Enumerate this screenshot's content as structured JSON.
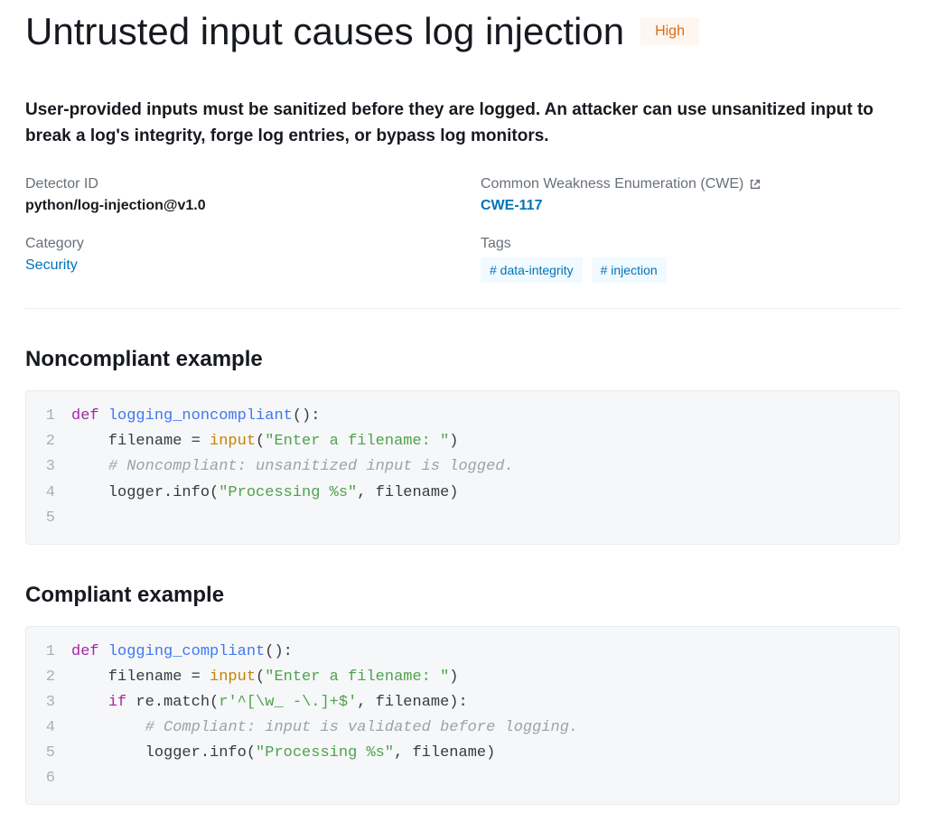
{
  "header": {
    "title": "Untrusted input causes log injection",
    "severity": "High"
  },
  "description": "User-provided inputs must be sanitized before they are logged. An attacker can use unsanitized input to break a log's integrity, forge log entries, or bypass log monitors.",
  "meta": {
    "detector_id_label": "Detector ID",
    "detector_id": "python/log-injection@v1.0",
    "cwe_label": "Common Weakness Enumeration (CWE)",
    "cwe_link": "CWE-117",
    "category_label": "Category",
    "category": "Security",
    "tags_label": "Tags",
    "tags": [
      "# data-integrity",
      "# injection"
    ]
  },
  "sections": {
    "noncompliant_title": "Noncompliant example",
    "compliant_title": "Compliant example"
  },
  "code": {
    "noncompliant": [
      {
        "n": "1",
        "tokens": [
          [
            "kw",
            "def "
          ],
          [
            "fn",
            "logging_noncompliant"
          ],
          [
            "plain",
            "():"
          ]
        ]
      },
      {
        "n": "2",
        "tokens": [
          [
            "plain",
            "    filename = "
          ],
          [
            "builtin",
            "input"
          ],
          [
            "plain",
            "("
          ],
          [
            "str",
            "\"Enter a filename: \""
          ],
          [
            "plain",
            ")"
          ]
        ]
      },
      {
        "n": "3",
        "tokens": [
          [
            "plain",
            "    "
          ],
          [
            "comment",
            "# Noncompliant: unsanitized input is logged."
          ]
        ]
      },
      {
        "n": "4",
        "tokens": [
          [
            "plain",
            "    logger.info("
          ],
          [
            "str",
            "\"Processing %s\""
          ],
          [
            "plain",
            ", filename)"
          ]
        ]
      },
      {
        "n": "5",
        "tokens": []
      }
    ],
    "compliant": [
      {
        "n": "1",
        "tokens": [
          [
            "kw",
            "def "
          ],
          [
            "fn",
            "logging_compliant"
          ],
          [
            "plain",
            "():"
          ]
        ]
      },
      {
        "n": "2",
        "tokens": [
          [
            "plain",
            "    filename = "
          ],
          [
            "builtin",
            "input"
          ],
          [
            "plain",
            "("
          ],
          [
            "str",
            "\"Enter a filename: \""
          ],
          [
            "plain",
            ")"
          ]
        ]
      },
      {
        "n": "3",
        "tokens": [
          [
            "plain",
            "    "
          ],
          [
            "kw",
            "if"
          ],
          [
            "plain",
            " re.match("
          ],
          [
            "str",
            "r'^[\\w_ -\\.]+$'"
          ],
          [
            "plain",
            ", filename):"
          ]
        ]
      },
      {
        "n": "4",
        "tokens": [
          [
            "plain",
            "        "
          ],
          [
            "comment",
            "# Compliant: input is validated before logging."
          ]
        ]
      },
      {
        "n": "5",
        "tokens": [
          [
            "plain",
            "        logger.info("
          ],
          [
            "str",
            "\"Processing %s\""
          ],
          [
            "plain",
            ", filename)"
          ]
        ]
      },
      {
        "n": "6",
        "tokens": []
      }
    ]
  }
}
